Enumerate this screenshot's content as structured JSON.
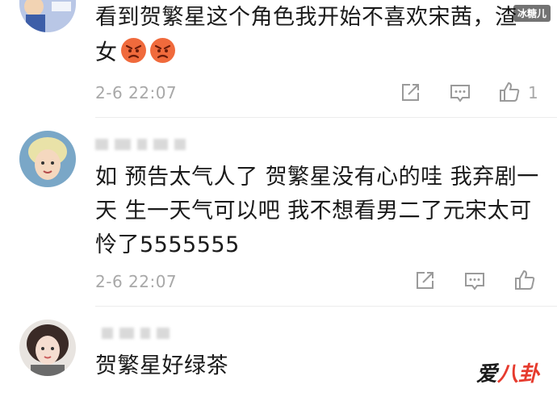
{
  "watermark_top": "冰糖儿",
  "watermark_logo": {
    "part1": "爱",
    "part2": "八卦"
  },
  "comments": [
    {
      "lines": [
        "看到贺繁星这个角色我开始不喜欢宋茜，渣",
        "女"
      ],
      "emoji_icon": "angry-face-icon",
      "timestamp": "2-6 22:07",
      "like_count": "1"
    },
    {
      "lines": [
        "如 预告太气人了 贺繁星没有心的哇 我弃剧一",
        "天 生一天气可以吧 我不想看男二了元宋太可",
        "怜了5555555"
      ],
      "timestamp": "2-6 22:07",
      "like_count": ""
    },
    {
      "lines": [
        "贺繁星好绿茶"
      ],
      "timestamp": "",
      "like_count": ""
    }
  ],
  "colors": {
    "timestamp": "#a8a8a8",
    "emoji": "#f06a3c",
    "icon": "#9a9a9a"
  }
}
